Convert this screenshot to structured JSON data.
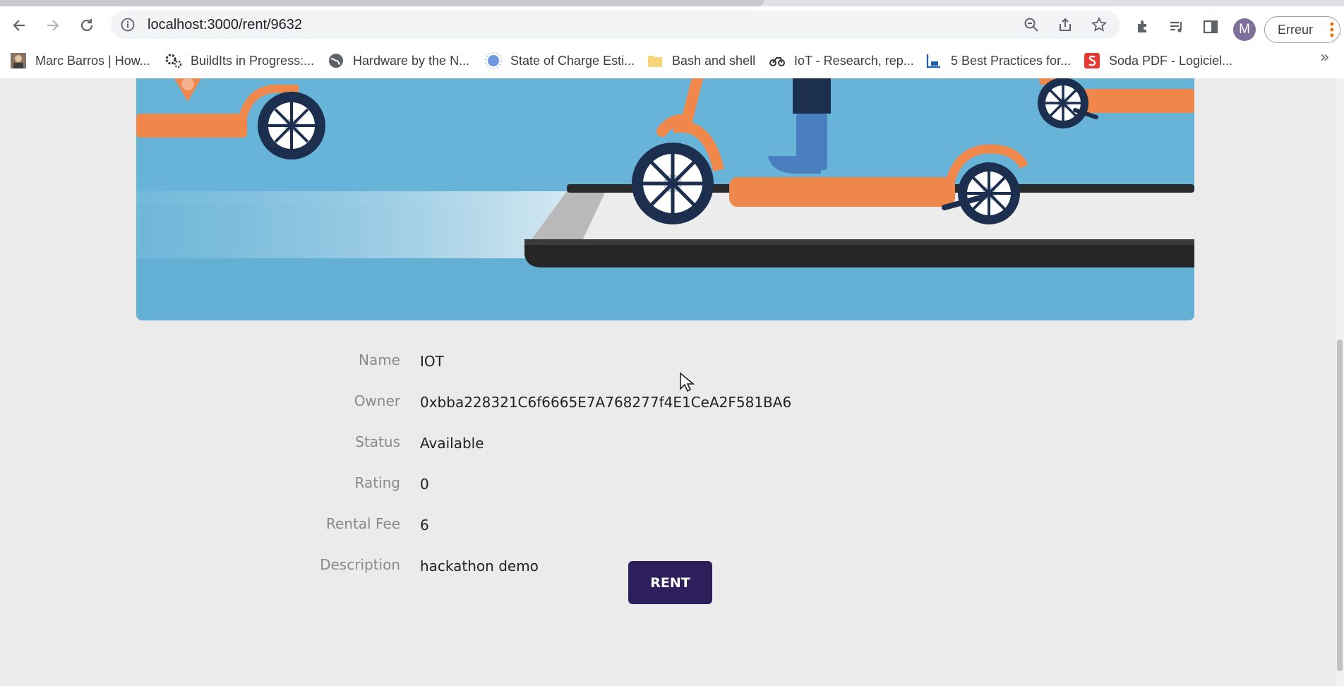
{
  "browser": {
    "url": "localhost:3000/rent/9632",
    "profile_initial": "M",
    "error_label": "Erreur",
    "icons": {
      "back": "back-arrow-icon",
      "forward": "forward-arrow-icon",
      "reload": "reload-icon",
      "info": "site-info-icon",
      "zoom": "zoom-out-icon",
      "share": "share-icon",
      "star": "bookmark-star-icon",
      "extensions": "puzzle-extension-icon",
      "media": "media-queue-icon",
      "sidepanel": "side-panel-icon"
    }
  },
  "bookmarks": [
    {
      "label": "Marc Barros | How...",
      "icon": "person-photo-icon"
    },
    {
      "label": "BuildIts in Progress:...",
      "icon": "gears-icon"
    },
    {
      "label": "Hardware by the N...",
      "icon": "globe-icon"
    },
    {
      "label": "State of Charge Esti...",
      "icon": "blue-blob-icon"
    },
    {
      "label": "Bash and shell",
      "icon": "folder-icon"
    },
    {
      "label": "IoT - Research, rep...",
      "icon": "bike-icon"
    },
    {
      "label": "5 Best Practices for...",
      "icon": "chart-icon"
    },
    {
      "label": "Soda PDF - Logiciel...",
      "icon": "soda-pdf-icon"
    }
  ],
  "details": {
    "fields": [
      {
        "label": "Name",
        "value": "IOT"
      },
      {
        "label": "Owner",
        "value": "0xbba228321C6f6665E7A768277f4E1CeA2F581BA6"
      },
      {
        "label": "Status",
        "value": "Available"
      },
      {
        "label": "Rating",
        "value": "0"
      },
      {
        "label": "Rental Fee",
        "value": "6"
      },
      {
        "label": "Description",
        "value": "hackathon demo"
      }
    ]
  },
  "actions": {
    "rent_label": "RENT"
  },
  "colors": {
    "hero_sky": "#63b0d4",
    "scooter_orange": "#f0874a",
    "wheel_navy": "#1c2f4f",
    "rent_button": "#2d1f5c"
  }
}
